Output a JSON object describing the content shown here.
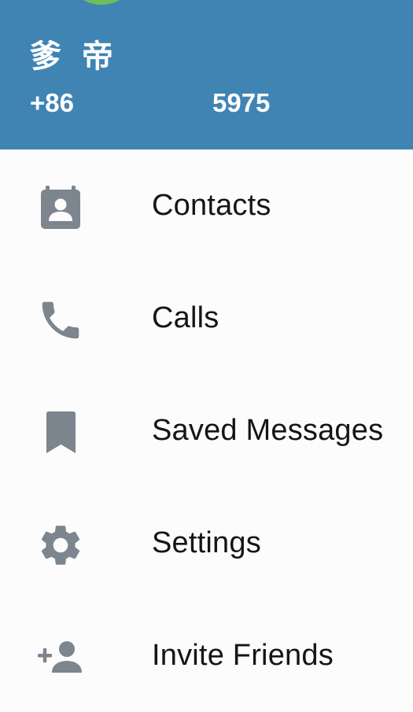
{
  "theme": {
    "header_bg": "#4084b4",
    "avatar_bg": "#6ebf5a",
    "icon_color": "#7d858e"
  },
  "profile": {
    "name": "爹 帝",
    "phone_prefix": "+86",
    "phone_suffix": "5975"
  },
  "menu": {
    "items": [
      {
        "label": "Contacts",
        "icon": "contacts-icon"
      },
      {
        "label": "Calls",
        "icon": "phone-icon"
      },
      {
        "label": "Saved Messages",
        "icon": "bookmark-icon"
      },
      {
        "label": "Settings",
        "icon": "gear-icon"
      },
      {
        "label": "Invite Friends",
        "icon": "add-person-icon"
      }
    ]
  }
}
